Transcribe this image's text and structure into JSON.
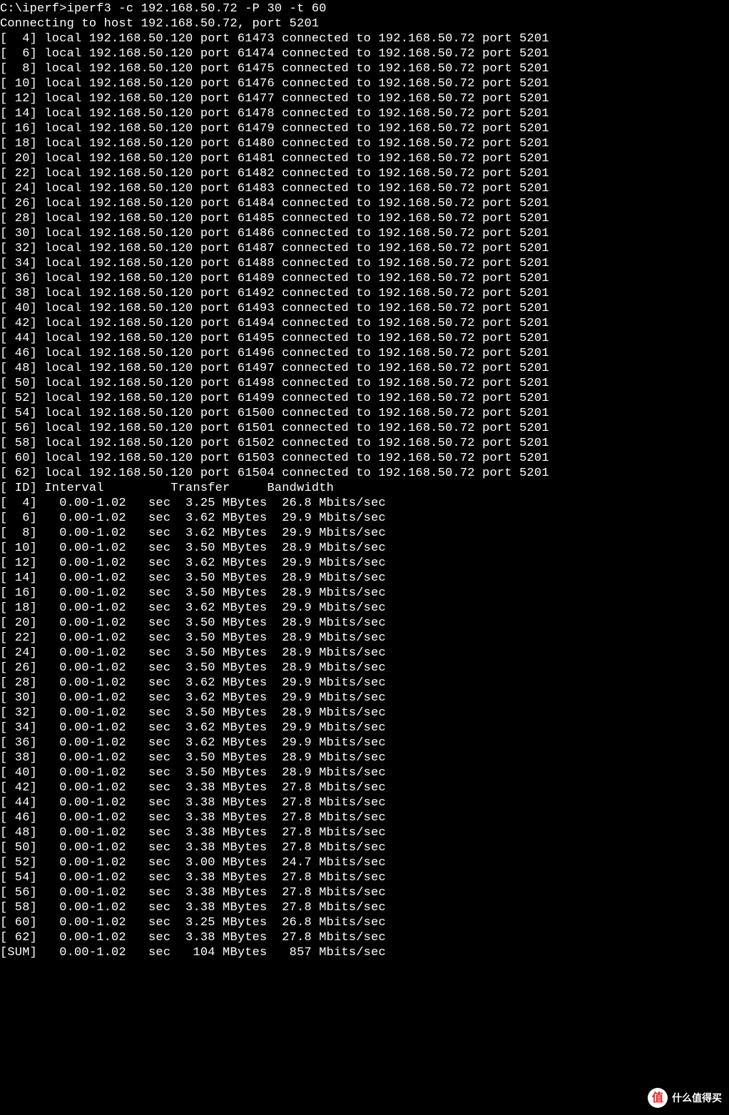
{
  "prompt": "C:\\iperf>",
  "command": "iperf3 -c 192.168.50.72 -P 30 -t 60",
  "connecting_line": "Connecting to host 192.168.50.72, port 5201",
  "local_ip": "192.168.50.120",
  "remote_ip": "192.168.50.72",
  "remote_port": "5201",
  "connections": [
    {
      "id": 4,
      "local_port": 61473
    },
    {
      "id": 6,
      "local_port": 61474
    },
    {
      "id": 8,
      "local_port": 61475
    },
    {
      "id": 10,
      "local_port": 61476
    },
    {
      "id": 12,
      "local_port": 61477
    },
    {
      "id": 14,
      "local_port": 61478
    },
    {
      "id": 16,
      "local_port": 61479
    },
    {
      "id": 18,
      "local_port": 61480
    },
    {
      "id": 20,
      "local_port": 61481
    },
    {
      "id": 22,
      "local_port": 61482
    },
    {
      "id": 24,
      "local_port": 61483
    },
    {
      "id": 26,
      "local_port": 61484
    },
    {
      "id": 28,
      "local_port": 61485
    },
    {
      "id": 30,
      "local_port": 61486
    },
    {
      "id": 32,
      "local_port": 61487
    },
    {
      "id": 34,
      "local_port": 61488
    },
    {
      "id": 36,
      "local_port": 61489
    },
    {
      "id": 38,
      "local_port": 61492
    },
    {
      "id": 40,
      "local_port": 61493
    },
    {
      "id": 42,
      "local_port": 61494
    },
    {
      "id": 44,
      "local_port": 61495
    },
    {
      "id": 46,
      "local_port": 61496
    },
    {
      "id": 48,
      "local_port": 61497
    },
    {
      "id": 50,
      "local_port": 61498
    },
    {
      "id": 52,
      "local_port": 61499
    },
    {
      "id": 54,
      "local_port": 61500
    },
    {
      "id": 56,
      "local_port": 61501
    },
    {
      "id": 58,
      "local_port": 61502
    },
    {
      "id": 60,
      "local_port": 61503
    },
    {
      "id": 62,
      "local_port": 61504
    }
  ],
  "header": {
    "id": "ID",
    "interval": "Interval",
    "transfer": "Transfer",
    "bandwidth": "Bandwidth"
  },
  "interval_str": "0.00-1.02",
  "interval_unit": "sec",
  "transfer_unit": "MBytes",
  "bandwidth_unit": "Mbits/sec",
  "stats": [
    {
      "id": "4",
      "transfer": "3.25",
      "bandwidth": "26.8"
    },
    {
      "id": "6",
      "transfer": "3.62",
      "bandwidth": "29.9"
    },
    {
      "id": "8",
      "transfer": "3.62",
      "bandwidth": "29.9"
    },
    {
      "id": "10",
      "transfer": "3.50",
      "bandwidth": "28.9"
    },
    {
      "id": "12",
      "transfer": "3.62",
      "bandwidth": "29.9"
    },
    {
      "id": "14",
      "transfer": "3.50",
      "bandwidth": "28.9"
    },
    {
      "id": "16",
      "transfer": "3.50",
      "bandwidth": "28.9"
    },
    {
      "id": "18",
      "transfer": "3.62",
      "bandwidth": "29.9"
    },
    {
      "id": "20",
      "transfer": "3.50",
      "bandwidth": "28.9"
    },
    {
      "id": "22",
      "transfer": "3.50",
      "bandwidth": "28.9"
    },
    {
      "id": "24",
      "transfer": "3.50",
      "bandwidth": "28.9"
    },
    {
      "id": "26",
      "transfer": "3.50",
      "bandwidth": "28.9"
    },
    {
      "id": "28",
      "transfer": "3.62",
      "bandwidth": "29.9"
    },
    {
      "id": "30",
      "transfer": "3.62",
      "bandwidth": "29.9"
    },
    {
      "id": "32",
      "transfer": "3.50",
      "bandwidth": "28.9"
    },
    {
      "id": "34",
      "transfer": "3.62",
      "bandwidth": "29.9"
    },
    {
      "id": "36",
      "transfer": "3.62",
      "bandwidth": "29.9"
    },
    {
      "id": "38",
      "transfer": "3.50",
      "bandwidth": "28.9"
    },
    {
      "id": "40",
      "transfer": "3.50",
      "bandwidth": "28.9"
    },
    {
      "id": "42",
      "transfer": "3.38",
      "bandwidth": "27.8"
    },
    {
      "id": "44",
      "transfer": "3.38",
      "bandwidth": "27.8"
    },
    {
      "id": "46",
      "transfer": "3.38",
      "bandwidth": "27.8"
    },
    {
      "id": "48",
      "transfer": "3.38",
      "bandwidth": "27.8"
    },
    {
      "id": "50",
      "transfer": "3.38",
      "bandwidth": "27.8"
    },
    {
      "id": "52",
      "transfer": "3.00",
      "bandwidth": "24.7"
    },
    {
      "id": "54",
      "transfer": "3.38",
      "bandwidth": "27.8"
    },
    {
      "id": "56",
      "transfer": "3.38",
      "bandwidth": "27.8"
    },
    {
      "id": "58",
      "transfer": "3.38",
      "bandwidth": "27.8"
    },
    {
      "id": "60",
      "transfer": "3.25",
      "bandwidth": "26.8"
    },
    {
      "id": "62",
      "transfer": "3.38",
      "bandwidth": "27.8"
    }
  ],
  "sum": {
    "id": "SUM",
    "transfer": "104",
    "bandwidth": "857"
  },
  "watermark": {
    "logo": "值",
    "text": "什么值得买"
  }
}
